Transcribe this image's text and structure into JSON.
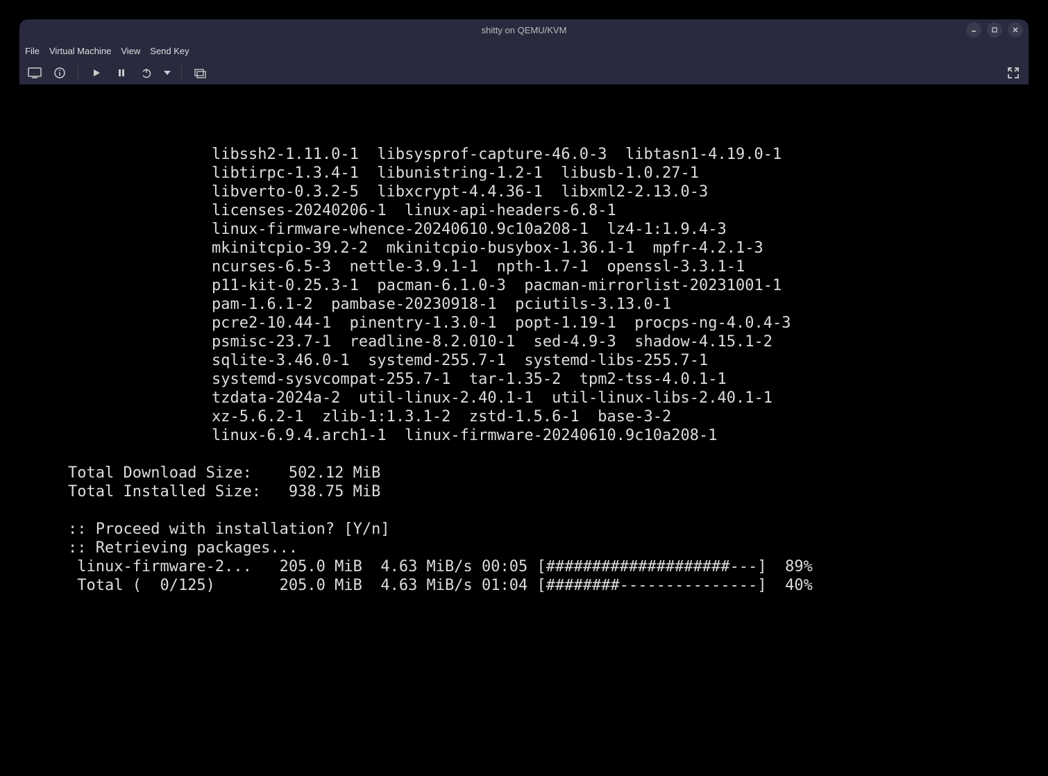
{
  "window": {
    "title": "shitty on QEMU/KVM"
  },
  "menu": {
    "file": "File",
    "vm": "Virtual Machine",
    "view": "View",
    "sendkey": "Send Key"
  },
  "terminal": {
    "pkg_lines": [
      "libssh2-1.11.0-1  libsysprof-capture-46.0-3  libtasn1-4.19.0-1",
      "libtirpc-1.3.4-1  libunistring-1.2-1  libusb-1.0.27-1",
      "libverto-0.3.2-5  libxcrypt-4.4.36-1  libxml2-2.13.0-3",
      "licenses-20240206-1  linux-api-headers-6.8-1",
      "linux-firmware-whence-20240610.9c10a208-1  lz4-1:1.9.4-3",
      "mkinitcpio-39.2-2  mkinitcpio-busybox-1.36.1-1  mpfr-4.2.1-3",
      "ncurses-6.5-3  nettle-3.9.1-1  npth-1.7-1  openssl-3.3.1-1",
      "p11-kit-0.25.3-1  pacman-6.1.0-3  pacman-mirrorlist-20231001-1",
      "pam-1.6.1-2  pambase-20230918-1  pciutils-3.13.0-1",
      "pcre2-10.44-1  pinentry-1.3.0-1  popt-1.19-1  procps-ng-4.0.4-3",
      "psmisc-23.7-1  readline-8.2.010-1  sed-4.9-3  shadow-4.15.1-2",
      "sqlite-3.46.0-1  systemd-255.7-1  systemd-libs-255.7-1",
      "systemd-sysvcompat-255.7-1  tar-1.35-2  tpm2-tss-4.0.1-1",
      "tzdata-2024a-2  util-linux-2.40.1-1  util-linux-libs-2.40.1-1",
      "xz-5.6.2-1  zlib-1:1.3.1-2  zstd-1.5.6-1  base-3-2",
      "linux-6.9.4.arch1-1  linux-firmware-20240610.9c10a208-1"
    ],
    "download_size_line": "Total Download Size:    502.12 MiB",
    "installed_size_line": "Total Installed Size:   938.75 MiB",
    "proceed_line": ":: Proceed with installation? [Y/n]",
    "retrieve_line": ":: Retrieving packages...",
    "progress1": " linux-firmware-2...   205.0 MiB  4.63 MiB/s 00:05 [####################---]  89%",
    "progress2": " Total (  0/125)       205.0 MiB  4.63 MiB/s 01:04 [########---------------]  40%"
  }
}
